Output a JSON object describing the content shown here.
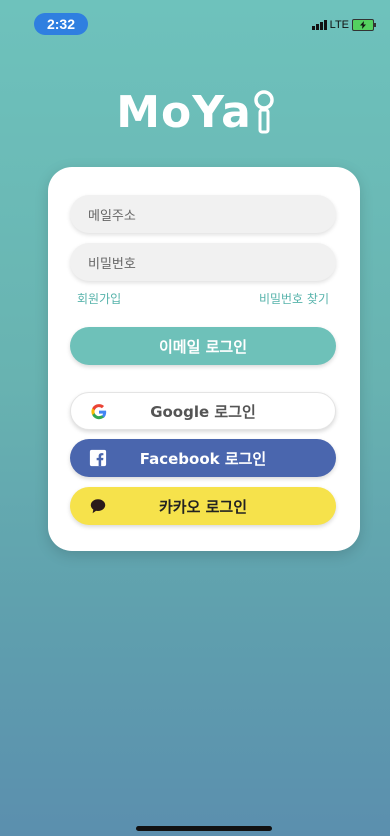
{
  "status_bar": {
    "time": "2:32",
    "network": "LTE"
  },
  "app": {
    "logo_text": "MoYa"
  },
  "form": {
    "email_placeholder": "메일주소",
    "password_placeholder": "비밀번호",
    "signup_link": "회원가입",
    "find_password_link": "비밀번호 찾기"
  },
  "buttons": {
    "email_login": "이메일 로그인",
    "google_login": "Google 로그인",
    "facebook_login": "Facebook 로그인",
    "kakao_login": "카카오 로그인"
  },
  "colors": {
    "accent": "#6ec1b9",
    "facebook": "#4a66ae",
    "kakao": "#f6e24b",
    "background_top": "#6ec2bc",
    "background_bottom": "#5b8fae"
  }
}
